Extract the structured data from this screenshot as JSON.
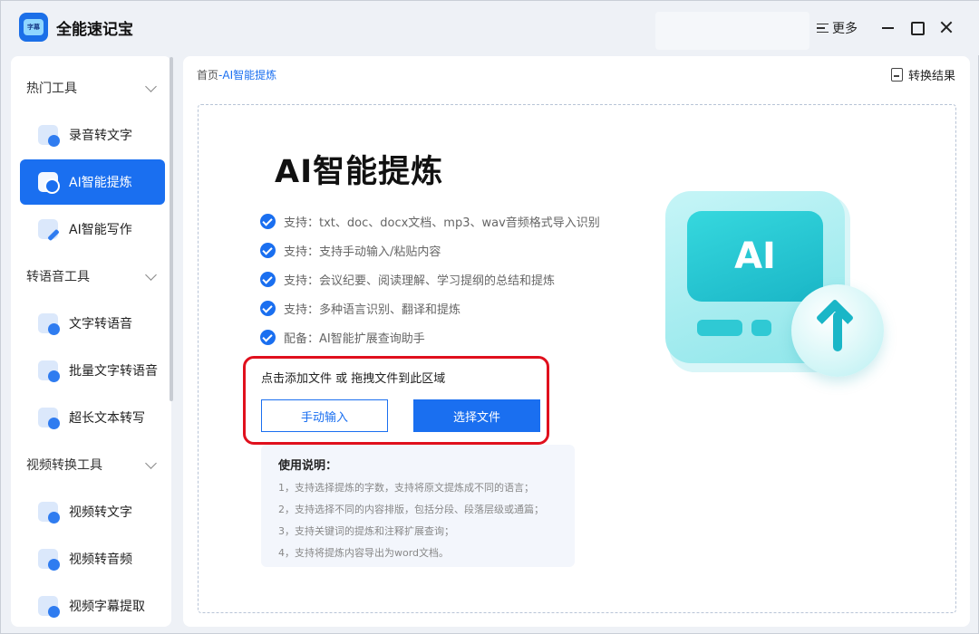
{
  "app": {
    "title": "全能速记宝",
    "more_label": "更多",
    "logo_text": "字幕"
  },
  "sidebar": {
    "groups": [
      {
        "label": "热门工具",
        "items": [
          {
            "label": "录音转文字"
          },
          {
            "label": "AI智能提炼",
            "active": true
          },
          {
            "label": "AI智能写作"
          }
        ]
      },
      {
        "label": "转语音工具",
        "items": [
          {
            "label": "文字转语音"
          },
          {
            "label": "批量文字转语音"
          },
          {
            "label": "超长文本转写"
          }
        ]
      },
      {
        "label": "视频转换工具",
        "items": [
          {
            "label": "视频转文字"
          },
          {
            "label": "视频转音频"
          },
          {
            "label": "视频字幕提取"
          }
        ]
      }
    ]
  },
  "main": {
    "breadcrumb": {
      "home": "首页",
      "separator": "-",
      "current": "AI智能提炼"
    },
    "result_label": "转换结果",
    "heading": "AI智能提炼",
    "features": [
      "支持：txt、doc、docx文档、mp3、wav音频格式导入识别",
      "支持：支持手动输入/粘贴内容",
      "支持：会议纪要、阅读理解、学习提纲的总结和提炼",
      "支持：多种语言识别、翻译和提炼",
      "配备：AI智能扩展查询助手"
    ],
    "upload": {
      "hint": "点击添加文件 或 拖拽文件到此区域",
      "manual_button": "手动输入",
      "select_button": "选择文件"
    },
    "instructions": {
      "title": "使用说明：",
      "items": [
        "1，支持选择提炼的字数，支持将原文提炼成不同的语言；",
        "2，支持选择不同的内容排版，包括分段、段落层级或通篇；",
        "3，支持关键词的提炼和注释扩展查询；",
        "4，支持将提炼内容导出为word文档。"
      ]
    },
    "illustration_text": "AI"
  },
  "colors": {
    "accent": "#1a6ff0",
    "highlight_border": "#e0101d",
    "illustration": "#1ab6c7"
  }
}
